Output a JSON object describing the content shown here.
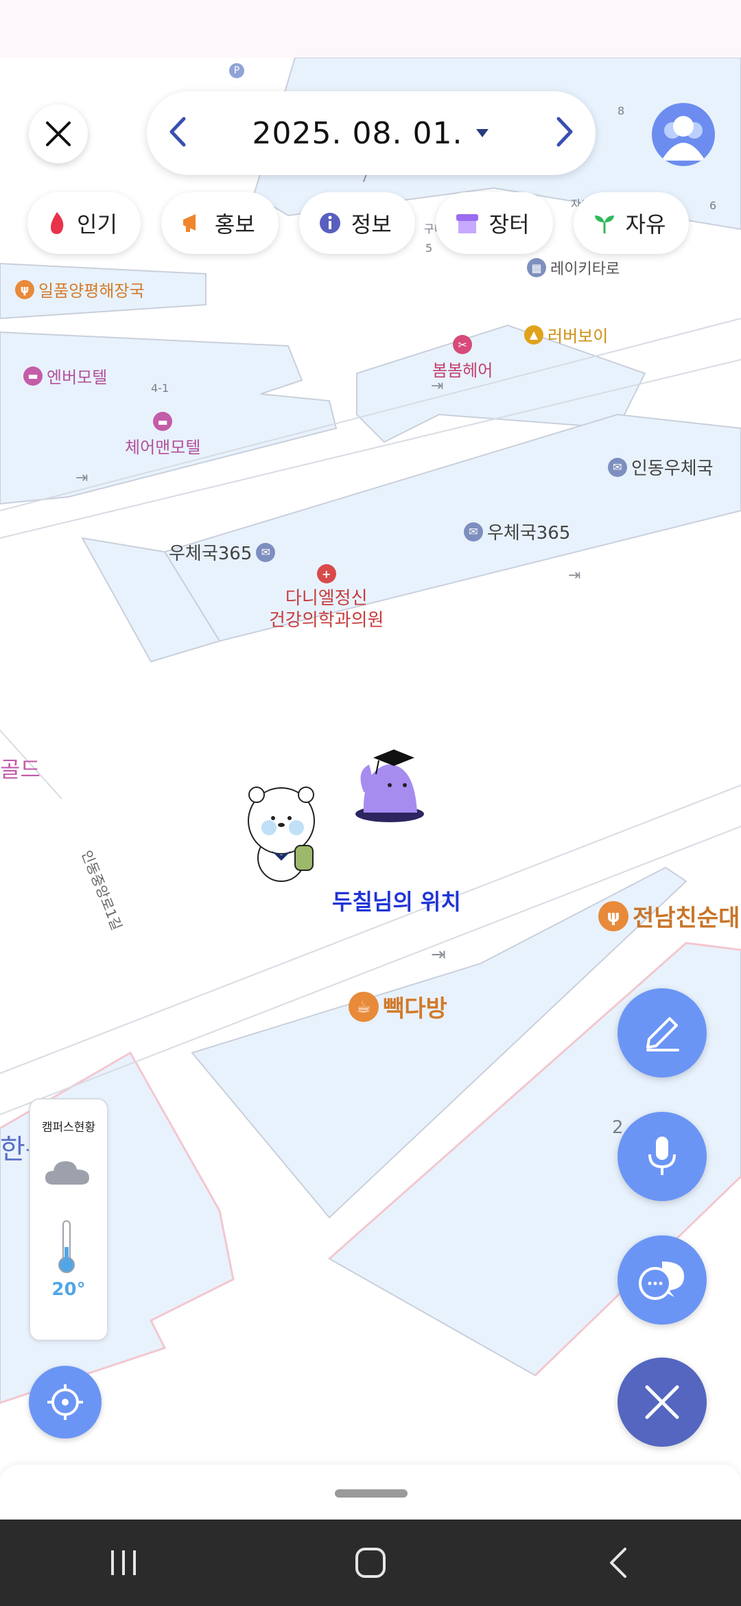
{
  "header": {
    "date": "2025. 08. 01.",
    "prev_icon": "chevron-left-icon",
    "next_icon": "chevron-right-icon",
    "dropdown_icon": "caret-down-icon"
  },
  "categories": [
    {
      "label": "인기",
      "icon": "flame-icon",
      "color": "#e8334a"
    },
    {
      "label": "홍보",
      "icon": "megaphone-icon",
      "color": "#f0852c"
    },
    {
      "label": "정보",
      "icon": "info-icon",
      "color": "#5a5fbf"
    },
    {
      "label": "장터",
      "icon": "store-icon",
      "color": "#9b6cf0"
    },
    {
      "label": "자유",
      "icon": "sprout-icon",
      "color": "#2fb85a"
    }
  ],
  "map": {
    "pois": [
      {
        "label": "일품양평해장국",
        "icon": "restaurant-icon",
        "color": "#e88a3a"
      },
      {
        "label": "엔버모텔",
        "icon": "bed-icon",
        "color": "#c35da8"
      },
      {
        "label": "체어맨모텔",
        "icon": "bed-icon",
        "color": "#c35da8"
      },
      {
        "label": "봄봄헤어",
        "icon": "scissors-icon",
        "color": "#d64a7a"
      },
      {
        "label": "러버보이",
        "icon": "bag-icon",
        "color": "#e0a21a"
      },
      {
        "label": "레이키타로",
        "icon": "building-icon",
        "color": "#7e8fbf"
      },
      {
        "label": "인동우체국",
        "icon": "post-icon",
        "color": "#7e8fbf"
      },
      {
        "label": "우체국365",
        "icon": "post-icon",
        "color": "#7e8fbf"
      },
      {
        "label": "우체국365",
        "icon": "post-icon",
        "color": "#7e8fbf"
      },
      {
        "label": "다니엘정신\n건강의학과의원",
        "icon": "hospital-icon",
        "color": "#d94a4a"
      },
      {
        "label": "전남친순대",
        "icon": "restaurant-icon",
        "color": "#e88a3a"
      },
      {
        "label": "빽다방",
        "icon": "cafe-icon",
        "color": "#e88a3a"
      },
      {
        "label": "골드",
        "icon": "",
        "color": "#c35da8"
      },
      {
        "label": "한은행",
        "icon": "",
        "color": "#5a6fc8"
      }
    ],
    "road_labels": [
      "인동중앙로1길"
    ],
    "small_labels": [
      "자이",
      "구미",
      "4-1",
      "5",
      "6",
      "7",
      "8",
      "2"
    ],
    "my_location_label": "두칠님의 위치"
  },
  "campus": {
    "title": "캠퍼스현황",
    "weather_icon": "cloud-icon",
    "temperature": "20°",
    "thermometer_icon": "thermometer-icon"
  },
  "fabs": [
    {
      "name": "write-button",
      "icon": "pencil-icon"
    },
    {
      "name": "voice-button",
      "icon": "microphone-icon"
    },
    {
      "name": "chat-button",
      "icon": "chat-bubbles-icon"
    },
    {
      "name": "close-menu-button",
      "icon": "close-icon"
    }
  ],
  "navbar": [
    "recent-apps-icon",
    "home-icon",
    "back-icon"
  ],
  "colors": {
    "accent": "#6b95f5",
    "accent_dark": "#5466c0",
    "map_block": "#e8f2fd",
    "map_block_pink": "#f3c7cf",
    "my_location_text": "#2035d6"
  }
}
